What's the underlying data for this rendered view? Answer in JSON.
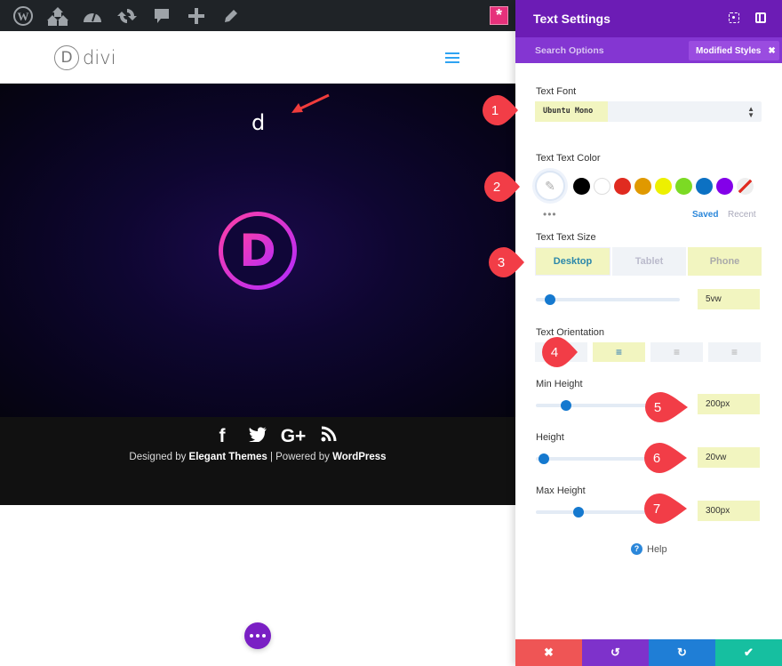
{
  "admin_bar": {
    "icons": [
      "wordpress-icon",
      "my-sites-icon",
      "dashboard-icon",
      "updates-icon",
      "comments-icon",
      "new-icon",
      "edit-icon"
    ],
    "visual_builder_icon": "asterisk-icon",
    "visual_builder_glyph": "*"
  },
  "site": {
    "logo_letter": "D",
    "logo_text": "divi",
    "hero_text": "d",
    "badge_letter": "D",
    "social_icons": [
      {
        "name": "facebook-icon",
        "glyph": "f"
      },
      {
        "name": "twitter-icon",
        "glyph": "🐦"
      },
      {
        "name": "google-plus-icon",
        "glyph": "G+"
      },
      {
        "name": "rss-icon",
        "glyph": "∂"
      }
    ],
    "credits": {
      "prefix": "Designed by ",
      "brand": "Elegant Themes",
      "sep": " | Powered by ",
      "platform": "WordPress"
    }
  },
  "panel": {
    "title": "Text Settings",
    "search_label": "Search Options",
    "filter_label": "Modified Styles",
    "filter_close": "✖",
    "text_font": {
      "label": "Text Font",
      "value": "Ubuntu Mono"
    },
    "text_color": {
      "label": "Text Text Color",
      "swatches": [
        "#000000",
        "#ffffff",
        "#e02b20",
        "#e09900",
        "#edf000",
        "#7cda24",
        "#0c71c3",
        "#8300e9"
      ],
      "more": "•••",
      "saved": "Saved",
      "recent": "Recent"
    },
    "text_size": {
      "label": "Text Text Size",
      "tabs": [
        "Desktop",
        "Tablet",
        "Phone"
      ],
      "active_tab": "Desktop",
      "value": "5vw",
      "slider_fraction": 0.06
    },
    "orientation": {
      "label": "Text Orientation",
      "options": [
        "left",
        "center",
        "right",
        "justify"
      ],
      "active": "center"
    },
    "min_height": {
      "label": "Min Height",
      "value": "200px",
      "slider_fraction": 0.2
    },
    "height": {
      "label": "Height",
      "value": "20vw",
      "slider_fraction": 0.02
    },
    "max_height": {
      "label": "Max Height",
      "value": "300px",
      "slider_fraction": 0.3
    },
    "help": "Help",
    "actions": [
      {
        "name": "discard-button",
        "glyph": "✖",
        "color": "#ef5555"
      },
      {
        "name": "undo-button",
        "glyph": "↺",
        "color": "#7e32cb"
      },
      {
        "name": "redo-button",
        "glyph": "↻",
        "color": "#1f7ed6"
      },
      {
        "name": "save-button",
        "glyph": "✔",
        "color": "#16bfa0"
      }
    ]
  },
  "markers": [
    "1",
    "2",
    "3",
    "4",
    "5",
    "6",
    "7"
  ]
}
